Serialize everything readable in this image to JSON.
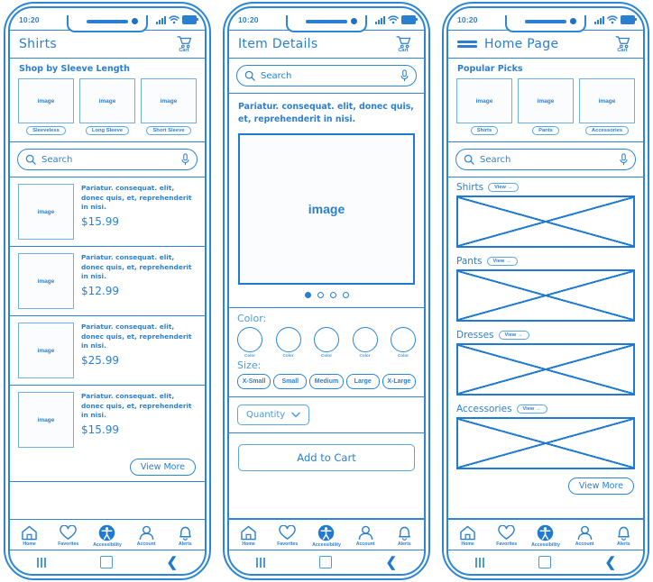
{
  "meta": {
    "accent": "#2b7fd0",
    "line": "#2b86d6",
    "light": "#6eb0e4",
    "image_placeholder": "image"
  },
  "status_bar": {
    "time": "10:20",
    "signal_icon": "signal-bars-icon",
    "wifi_icon": "wifi-icon",
    "battery_icon": "battery-icon"
  },
  "bottom_nav": [
    {
      "label": "Home",
      "icon": "home-icon"
    },
    {
      "label": "Favorites",
      "icon": "heart-icon"
    },
    {
      "label": "Accessibility",
      "icon": "accessibility-icon"
    },
    {
      "label": "Account",
      "icon": "person-icon"
    },
    {
      "label": "Alerts",
      "icon": "bell-icon"
    }
  ],
  "android_keys": [
    {
      "name": "recent-apps-key",
      "icon": "three-bars-icon"
    },
    {
      "name": "home-key",
      "icon": "square-icon"
    },
    {
      "name": "back-key",
      "icon": "chevron-left-icon"
    }
  ],
  "screen1": {
    "title": "Shirts",
    "cart": {
      "label": "Cart",
      "icon": "cart-icon"
    },
    "category_section": {
      "title": "Shop by Sleeve Length",
      "items": [
        {
          "label": "Sleeveless",
          "image": "image"
        },
        {
          "label": "Long Sleeve",
          "image": "image"
        },
        {
          "label": "Short Sleeve",
          "image": "image"
        }
      ]
    },
    "search": {
      "placeholder": "Search",
      "search_icon": "search-icon",
      "mic_icon": "microphone-icon"
    },
    "products": [
      {
        "image": "image",
        "description": "Pariatur. consequat. elit, donec quis, et, reprehenderit in nisi.",
        "price": "$15.99"
      },
      {
        "image": "image",
        "description": "Pariatur. consequat. elit, donec quis, et, reprehenderit in nisi.",
        "price": "$12.99"
      },
      {
        "image": "image",
        "description": "Pariatur. consequat. elit, donec quis, et, reprehenderit in nisi.",
        "price": "$25.99"
      },
      {
        "image": "image",
        "description": "Pariatur. consequat. elit, donec quis, et, reprehenderit in nisi.",
        "price": "$15.99"
      }
    ],
    "view_more": "View More"
  },
  "screen2": {
    "title": "Item Details",
    "cart": {
      "label": "Cart",
      "icon": "cart-icon"
    },
    "search": {
      "placeholder": "Search",
      "search_icon": "search-icon",
      "mic_icon": "microphone-icon"
    },
    "description": "Pariatur. consequat. elit, donec quis, et, reprehenderit in nisi.",
    "hero_image": "image",
    "carousel": {
      "total": 4,
      "active": 1
    },
    "color": {
      "label": "Color:",
      "swatches": [
        "Color",
        "Color",
        "Color",
        "Color",
        "Color"
      ]
    },
    "size": {
      "label": "Size:",
      "options": [
        "X-Small",
        "Small",
        "Medium",
        "Large",
        "X-Large"
      ]
    },
    "quantity": {
      "label": "Quantity",
      "chevron": "chevron-down-icon"
    },
    "add_to_cart": "Add to Cart"
  },
  "screen3": {
    "title": "Home Page",
    "menu_icon": "hamburger-menu-icon",
    "cart": {
      "label": "Cart",
      "icon": "cart-icon"
    },
    "popular": {
      "title": "Popular Picks",
      "items": [
        {
          "label": "Shirts",
          "image": "image"
        },
        {
          "label": "Pants",
          "image": "image"
        },
        {
          "label": "Accessories",
          "image": "image"
        }
      ]
    },
    "search": {
      "placeholder": "Search",
      "search_icon": "search-icon",
      "mic_icon": "microphone-icon"
    },
    "sections": [
      {
        "title": "Shirts",
        "view": "View"
      },
      {
        "title": "Pants",
        "view": "View"
      },
      {
        "title": "Dresses",
        "view": "View"
      },
      {
        "title": "Accessories",
        "view": "View"
      }
    ],
    "view_more": "View More"
  }
}
